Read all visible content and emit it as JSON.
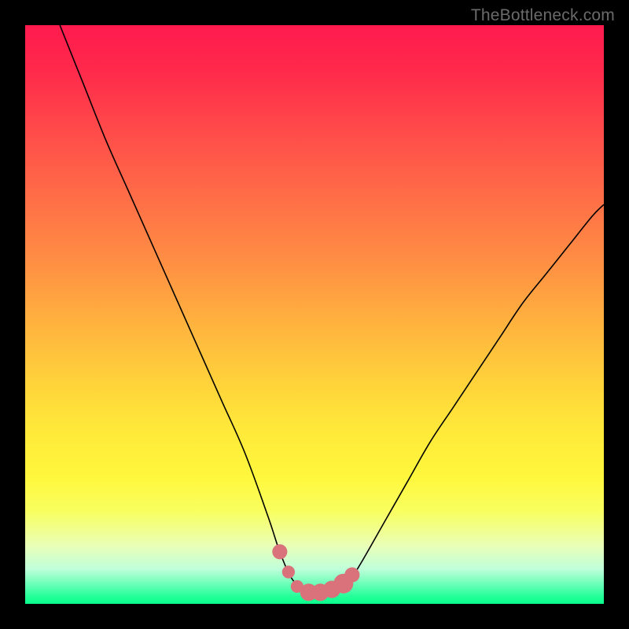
{
  "watermark": "TheBottleneck.com",
  "colors": {
    "background": "#000000",
    "curve": "#000000",
    "marker": "#d9727a",
    "gradient_stops": [
      "#ff1a4e",
      "#ff2a4b",
      "#ff4a4a",
      "#ff6e47",
      "#ff9243",
      "#ffb43e",
      "#ffd33a",
      "#ffe93a",
      "#fff73c",
      "#f9ff60",
      "#e9ffb8",
      "#bfffda",
      "#5dffb2",
      "#1cff96",
      "#0aff8e"
    ]
  },
  "chart_data": {
    "type": "line",
    "title": "",
    "xlabel": "",
    "ylabel": "",
    "xlim": [
      0,
      100
    ],
    "ylim": [
      0,
      100
    ],
    "series": [
      {
        "name": "bottleneck-curve",
        "x": [
          6,
          10,
          14,
          18,
          22,
          26,
          30,
          34,
          38,
          42,
          44,
          46,
          48,
          50,
          52,
          54,
          56,
          58,
          62,
          66,
          70,
          74,
          78,
          82,
          86,
          90,
          94,
          98,
          100
        ],
        "y": [
          100,
          90,
          80,
          71,
          62,
          53,
          44,
          35,
          26,
          15,
          9,
          4.5,
          2.5,
          2,
          2,
          2.5,
          4,
          7,
          14,
          21,
          28,
          34,
          40,
          46,
          52,
          57,
          62,
          67,
          69
        ]
      }
    ],
    "markers": {
      "name": "valley-markers",
      "x": [
        44,
        45.5,
        47,
        49,
        51,
        53,
        55,
        56.5
      ],
      "y": [
        9,
        5.5,
        3,
        2,
        2,
        2.5,
        3.5,
        5
      ],
      "r": [
        1.3,
        1.1,
        1.1,
        1.5,
        1.5,
        1.5,
        1.7,
        1.3
      ]
    }
  }
}
